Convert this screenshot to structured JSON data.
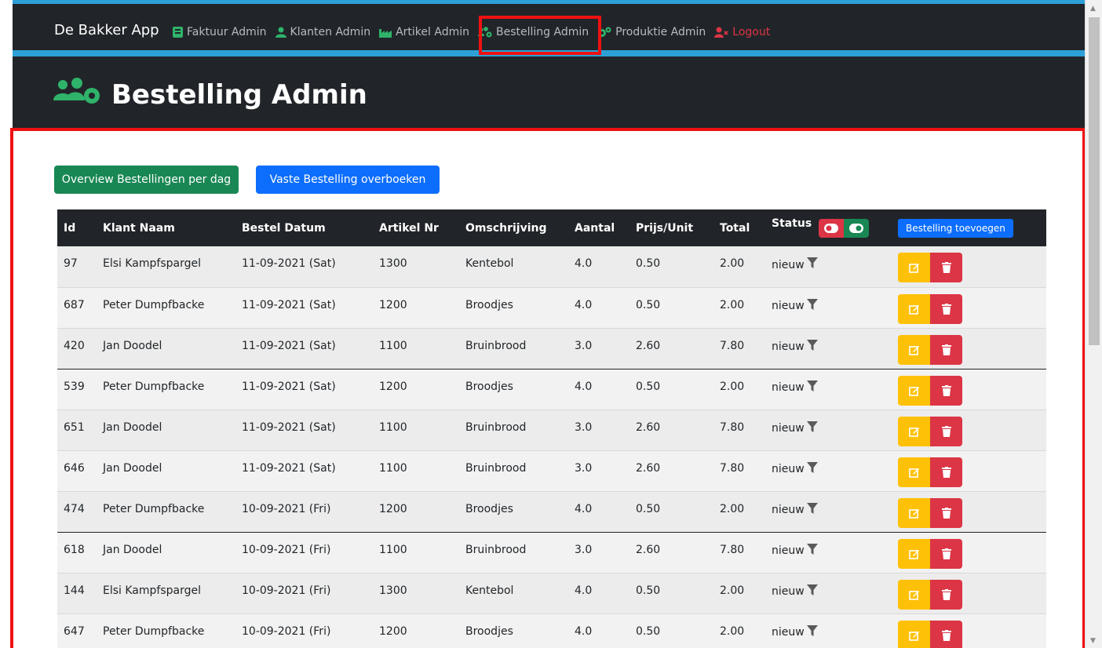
{
  "navbar": {
    "brand": "De Bakker App",
    "items": [
      {
        "label": "Faktuur Admin",
        "icon": "invoice-icon"
      },
      {
        "label": "Klanten Admin",
        "icon": "user-icon"
      },
      {
        "label": "Artikel Admin",
        "icon": "industry-icon"
      },
      {
        "label": "Bestelling Admin",
        "icon": "users-cog-icon"
      },
      {
        "label": "Produktie Admin",
        "icon": "cogs-icon"
      },
      {
        "label": "Logout",
        "icon": "user-times-icon"
      }
    ]
  },
  "header": {
    "title": "Bestelling Admin"
  },
  "toolbar": {
    "overview_label": "Overview Bestellingen per dag",
    "vaste_label": "Vaste Bestelling overboeken"
  },
  "table": {
    "columns": [
      "Id",
      "Klant Naam",
      "Bestel Datum",
      "Artikel Nr",
      "Omschrijving",
      "Aantal",
      "Prijs/Unit",
      "Total",
      "Status"
    ],
    "add_label": "Bestelling toevoegen",
    "rows": [
      [
        "97",
        "Elsi Kampfspargel",
        "11-09-2021 (Sat)",
        "1300",
        "Kentebol",
        "4.0",
        "0.50",
        "2.00",
        "nieuw"
      ],
      [
        "687",
        "Peter Dumpfbacke",
        "11-09-2021 (Sat)",
        "1200",
        "Broodjes",
        "4.0",
        "0.50",
        "2.00",
        "nieuw"
      ],
      [
        "420",
        "Jan Doodel",
        "11-09-2021 (Sat)",
        "1100",
        "Bruinbrood",
        "3.0",
        "2.60",
        "7.80",
        "nieuw"
      ],
      [
        "539",
        "Peter Dumpfbacke",
        "11-09-2021 (Sat)",
        "1200",
        "Broodjes",
        "4.0",
        "0.50",
        "2.00",
        "nieuw"
      ],
      [
        "651",
        "Jan Doodel",
        "11-09-2021 (Sat)",
        "1100",
        "Bruinbrood",
        "3.0",
        "2.60",
        "7.80",
        "nieuw"
      ],
      [
        "646",
        "Jan Doodel",
        "11-09-2021 (Sat)",
        "1100",
        "Bruinbrood",
        "3.0",
        "2.60",
        "7.80",
        "nieuw"
      ],
      [
        "474",
        "Peter Dumpfbacke",
        "10-09-2021 (Fri)",
        "1200",
        "Broodjes",
        "4.0",
        "0.50",
        "2.00",
        "nieuw"
      ],
      [
        "618",
        "Jan Doodel",
        "10-09-2021 (Fri)",
        "1100",
        "Bruinbrood",
        "3.0",
        "2.60",
        "7.80",
        "nieuw"
      ],
      [
        "144",
        "Elsi Kampfspargel",
        "10-09-2021 (Fri)",
        "1300",
        "Kentebol",
        "4.0",
        "0.50",
        "2.00",
        "nieuw"
      ],
      [
        "647",
        "Peter Dumpfbacke",
        "10-09-2021 (Fri)",
        "1200",
        "Broodjes",
        "4.0",
        "0.50",
        "2.00",
        "nieuw"
      ]
    ]
  },
  "colors": {
    "navbar_bg": "#212529",
    "accent_blue": "#2ea0d8",
    "highlight_red": "#ee1111",
    "success": "#198754",
    "primary": "#0d6efd",
    "warning": "#ffc107",
    "danger": "#dc3545"
  }
}
